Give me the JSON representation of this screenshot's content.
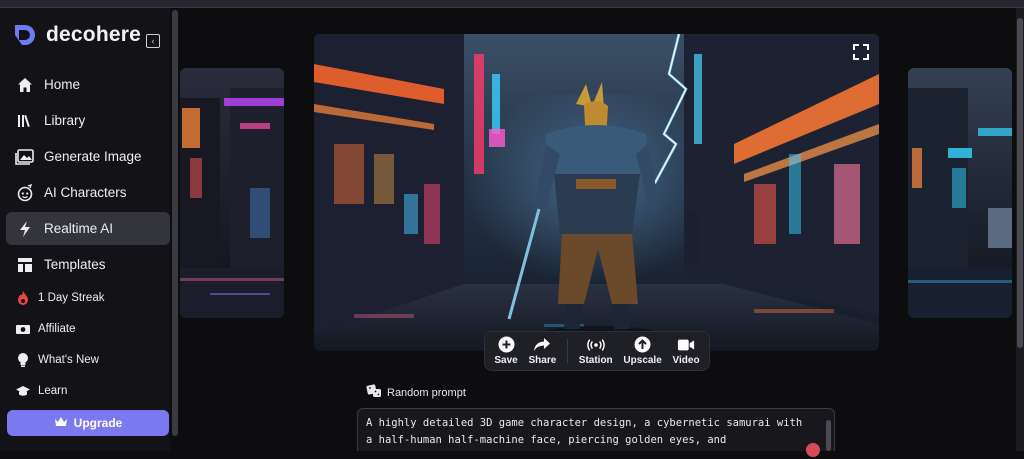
{
  "app": {
    "name": "decohere"
  },
  "sidebar": {
    "items": [
      {
        "label": "Home",
        "icon": "home-icon",
        "active": false
      },
      {
        "label": "Library",
        "icon": "library-icon",
        "active": false
      },
      {
        "label": "Generate Image",
        "icon": "image-icon",
        "active": false
      },
      {
        "label": "AI Characters",
        "icon": "character-icon",
        "active": false
      },
      {
        "label": "Realtime AI",
        "icon": "lightning-icon",
        "active": true
      },
      {
        "label": "Templates",
        "icon": "templates-icon",
        "active": false
      }
    ],
    "secondary": [
      {
        "label": "1 Day Streak",
        "icon": "flame-icon"
      },
      {
        "label": "Affiliate",
        "icon": "money-icon"
      },
      {
        "label": "What's New",
        "icon": "lightbulb-icon"
      },
      {
        "label": "Learn",
        "icon": "graduation-cap-icon"
      }
    ],
    "upgrade_label": "Upgrade"
  },
  "actions": [
    {
      "label": "Save",
      "icon": "plus-icon"
    },
    {
      "label": "Share",
      "icon": "share-icon"
    },
    {
      "label": "Station",
      "icon": "broadcast-icon"
    },
    {
      "label": "Upscale",
      "icon": "upscale-icon"
    },
    {
      "label": "Video",
      "icon": "video-icon"
    }
  ],
  "random_prompt_label": "Random prompt",
  "prompt_text": "A highly detailed 3D game character design, a cybernetic samurai with a half-human half-machine face, piercing golden eyes, and",
  "colors": {
    "accent": "#7b78f0",
    "active_bg": "#34343d",
    "sidebar_bg": "#131317"
  }
}
